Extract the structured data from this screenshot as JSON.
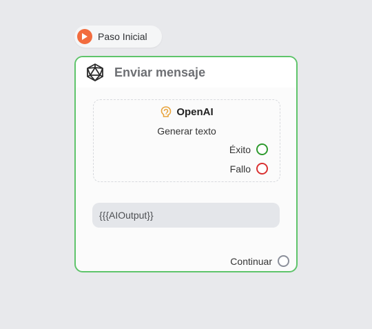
{
  "start": {
    "label": "Paso Inicial",
    "icon": "play-icon",
    "icon_color": "#f26c3e"
  },
  "node": {
    "title": "Enviar mensaje",
    "icon": "icosahedron-icon",
    "border_color": "#5ec46a",
    "block": {
      "provider": "OpenAI",
      "provider_icon": "openai-icon",
      "action": "Generar texto",
      "outputs": [
        {
          "label": "Éxito",
          "color": "#2e9a2e"
        },
        {
          "label": "Fallo",
          "color": "#d93030"
        }
      ]
    },
    "output_value": "{{{AIOutput}}",
    "continue_label": "Continuar",
    "continue_color": "#8b8f9a"
  }
}
